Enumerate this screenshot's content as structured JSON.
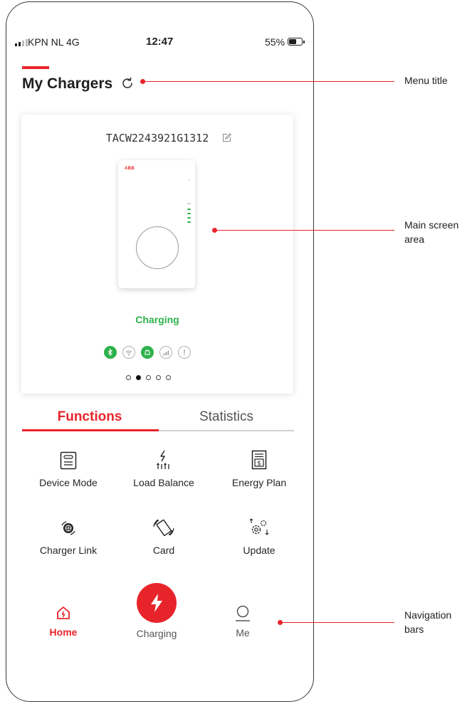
{
  "status_bar": {
    "carrier": "KPN NL  4G",
    "time": "12:47",
    "battery": "55%"
  },
  "header": {
    "title": "My Chargers"
  },
  "charger_card": {
    "charger_id": "TACW2243921G1312",
    "device_brand": "ABB",
    "status": "Charging",
    "status_color": "#2eb24b",
    "indicators": [
      {
        "name": "bluetooth-icon",
        "active": true
      },
      {
        "name": "wifi-icon",
        "active": false
      },
      {
        "name": "cloud-icon",
        "active": true
      },
      {
        "name": "cellular-icon",
        "active": false
      },
      {
        "name": "alert-icon",
        "active": false
      }
    ],
    "pager": {
      "count": 5,
      "active_index": 1
    }
  },
  "tabs": [
    {
      "label": "Functions",
      "active": true
    },
    {
      "label": "Statistics",
      "active": false
    }
  ],
  "functions": [
    {
      "label": "Device Mode",
      "icon": "device-mode-icon"
    },
    {
      "label": "Load Balance",
      "icon": "load-balance-icon"
    },
    {
      "label": "Energy Plan",
      "icon": "energy-plan-icon"
    },
    {
      "label": "Charger Link",
      "icon": "charger-link-icon"
    },
    {
      "label": "Card",
      "icon": "card-icon"
    },
    {
      "label": "Update",
      "icon": "update-icon"
    }
  ],
  "bottom_nav": {
    "home": "Home",
    "charging": "Charging",
    "me": "Me"
  },
  "annotations": {
    "menu_title": "Menu title",
    "main_screen_line1": "Main screen",
    "main_screen_line2": "area",
    "nav_line1": "Navigation",
    "nav_line2": "bars"
  },
  "colors": {
    "accent": "#e8242b",
    "status_green": "#2eb24b"
  }
}
